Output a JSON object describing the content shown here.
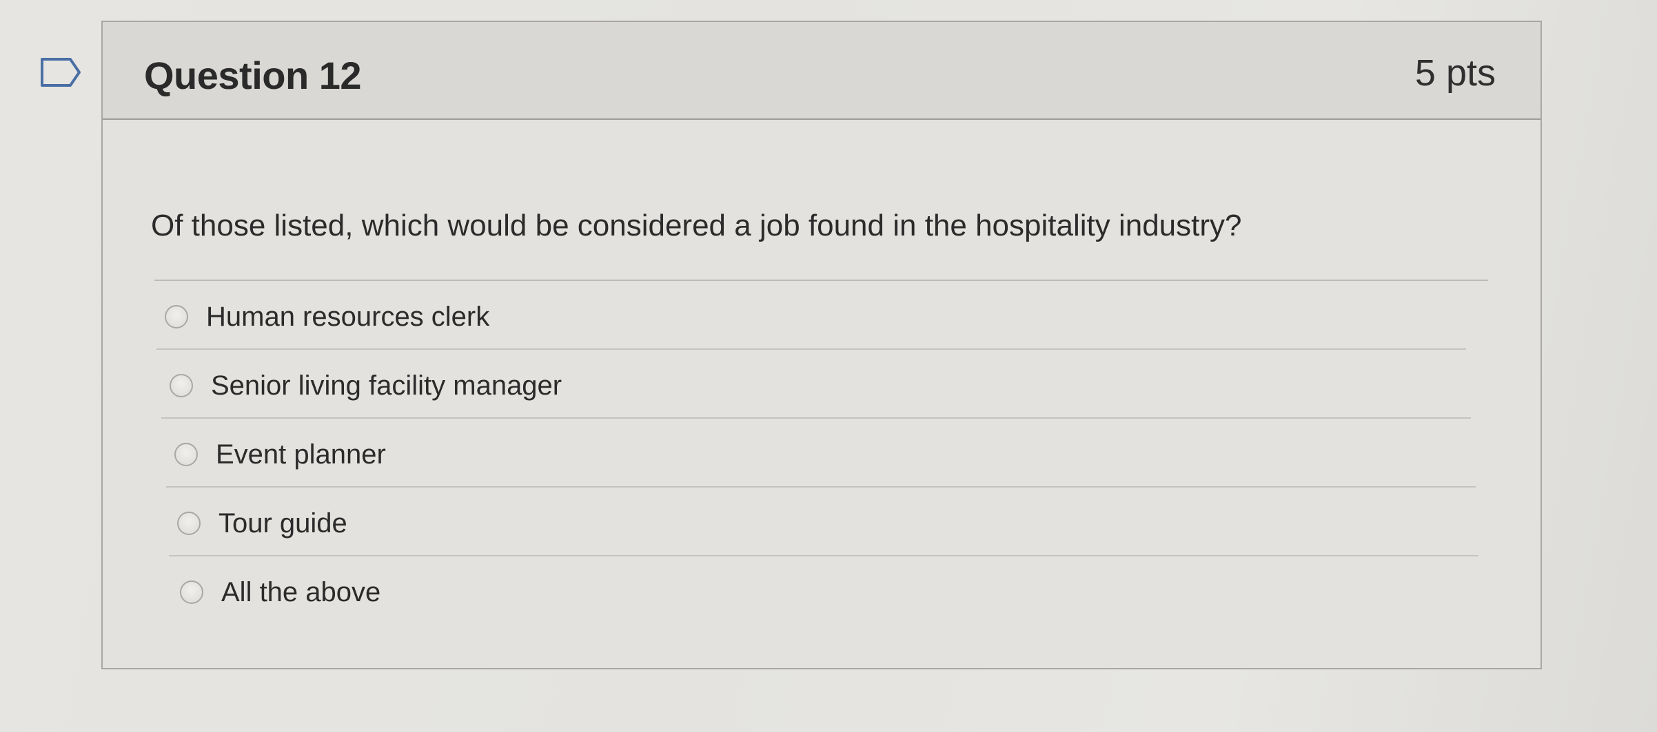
{
  "question": {
    "title": "Question 12",
    "points": "5 pts",
    "text": "Of those listed, which would be considered a job found in the hospitality industry?",
    "answers": [
      {
        "label": "Human resources clerk",
        "selected": false
      },
      {
        "label": "Senior living facility manager",
        "selected": false
      },
      {
        "label": "Event planner",
        "selected": false
      },
      {
        "label": "Tour guide",
        "selected": false
      },
      {
        "label": "All the above",
        "selected": false
      }
    ]
  },
  "icons": {
    "flag": "flag-outline-icon",
    "radio": "radio-unselected-icon"
  },
  "colors": {
    "background": "#e5e4e0",
    "header_background": "#d9d8d4",
    "border": "#a8a7a3",
    "text": "#2b2b2b",
    "flag_outline": "#4a6fa5"
  }
}
